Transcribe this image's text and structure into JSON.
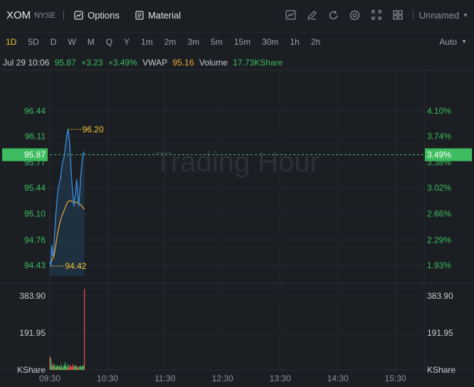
{
  "header": {
    "ticker": "XOM",
    "exchange": "NYSE",
    "options_label": "Options",
    "material_label": "Material",
    "layout_name": "Unnamed",
    "tools": [
      "chart-type-icon",
      "draw-pencil-icon",
      "reset-icon",
      "settings-gear-icon",
      "fullscreen-icon",
      "layout-grid-icon"
    ]
  },
  "periods": {
    "items": [
      "1D",
      "5D",
      "D",
      "W",
      "M",
      "Q",
      "Y",
      "1m",
      "2m",
      "3m",
      "5m",
      "15m",
      "30m",
      "1h",
      "2h"
    ],
    "active": "1D",
    "scale_mode": "Auto"
  },
  "infobar": {
    "datetime": "Jul 29 10:06",
    "price": "95.87",
    "change": "+3.23",
    "change_pct": "+3.49%",
    "vwap_label": "VWAP",
    "vwap_value": "95.16",
    "volume_label": "Volume",
    "volume_value": "17.73KShare"
  },
  "chart": {
    "watermark": "Trading Hour",
    "price_ticks_left": [
      "96.44",
      "96.11",
      "95.77",
      "95.44",
      "95.10",
      "94.76",
      "94.43"
    ],
    "pct_ticks_right": [
      "4.10%",
      "3.74%",
      "3.38%",
      "3.02%",
      "2.66%",
      "2.29%",
      "1.93%"
    ],
    "current_price_tag": "95.87",
    "current_pct_tag": "3.49%",
    "high_label": "96.20",
    "low_label": "94.42",
    "volume_ticks_left": [
      "383.90",
      "191.95",
      "KShare"
    ],
    "volume_ticks_right": [
      "383.90",
      "191.95",
      "KShare"
    ],
    "time_ticks": [
      "09:30",
      "10:30",
      "11:30",
      "12:30",
      "13:30",
      "14:30",
      "15:30"
    ],
    "colors": {
      "up": "#3dbd5f",
      "down": "#e04b4b",
      "price_line": "#3a8fe0",
      "vwap_line": "#f0a832",
      "highlow": "#f3c133",
      "tag_bg": "#3dbd5f"
    }
  },
  "chart_data": {
    "type": "line",
    "title": "",
    "xlabel": "",
    "ylabel": "",
    "ylim": [
      94.43,
      96.44
    ],
    "x": [
      "09:30",
      "09:31",
      "09:32",
      "09:33",
      "09:34",
      "09:35",
      "09:36",
      "09:37",
      "09:38",
      "09:39",
      "09:40",
      "09:41",
      "09:42",
      "09:43",
      "09:44",
      "09:45",
      "09:46",
      "09:47",
      "09:48",
      "09:49",
      "09:50",
      "09:51",
      "09:52",
      "09:53",
      "09:54",
      "09:55",
      "09:56",
      "09:57",
      "09:58",
      "09:59",
      "10:00",
      "10:01",
      "10:02",
      "10:03",
      "10:04",
      "10:05",
      "10:06"
    ],
    "series": [
      {
        "name": "Price",
        "values": [
          94.48,
          94.42,
          94.7,
          94.55,
          94.6,
          94.85,
          95.05,
          95.2,
          95.35,
          95.45,
          95.5,
          95.55,
          95.65,
          95.75,
          95.8,
          95.85,
          95.95,
          96.05,
          96.15,
          96.2,
          96.1,
          95.95,
          95.7,
          95.5,
          95.35,
          95.2,
          95.3,
          95.4,
          95.55,
          95.4,
          95.2,
          95.35,
          95.55,
          95.7,
          95.82,
          95.9,
          95.87
        ]
      },
      {
        "name": "VWAP",
        "values": [
          94.46,
          94.45,
          94.5,
          94.52,
          94.54,
          94.6,
          94.68,
          94.76,
          94.84,
          94.9,
          94.96,
          95.01,
          95.05,
          95.09,
          95.12,
          95.15,
          95.18,
          95.21,
          95.24,
          95.26,
          95.27,
          95.27,
          95.27,
          95.26,
          95.26,
          95.25,
          95.25,
          95.25,
          95.25,
          95.25,
          95.24,
          95.23,
          95.22,
          95.21,
          95.19,
          95.17,
          95.16
        ]
      }
    ],
    "volume": {
      "unit": "KShare",
      "ylim": [
        0,
        450
      ],
      "values": [
        70,
        60,
        25,
        35,
        20,
        30,
        15,
        20,
        25,
        18,
        22,
        15,
        30,
        12,
        18,
        25,
        40,
        20,
        15,
        30,
        12,
        25,
        20,
        15,
        30,
        22,
        18,
        25,
        15,
        20,
        12,
        18,
        22,
        15,
        20,
        25,
        420
      ],
      "up": [
        false,
        true,
        true,
        false,
        true,
        true,
        false,
        true,
        true,
        false,
        true,
        true,
        true,
        false,
        true,
        true,
        true,
        true,
        false,
        true,
        false,
        false,
        false,
        false,
        false,
        false,
        true,
        true,
        true,
        false,
        false,
        true,
        true,
        true,
        true,
        true,
        false
      ]
    },
    "high": 96.2,
    "low": 94.42,
    "last": 95.87
  }
}
